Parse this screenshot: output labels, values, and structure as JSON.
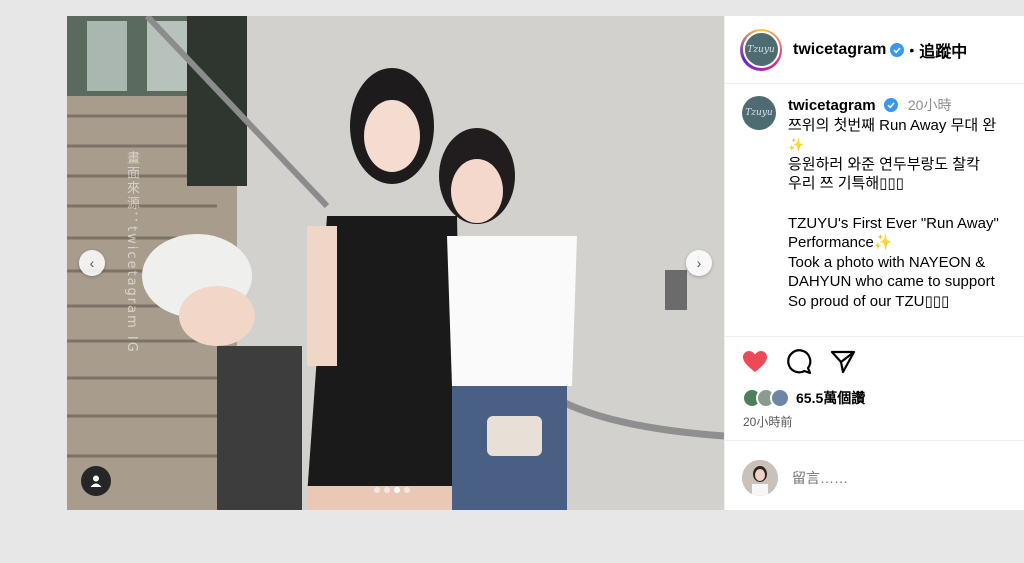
{
  "photo": {
    "watermark": "畫面來源：twicetagram IG",
    "nav_prev_label": "‹",
    "nav_next_label": "›",
    "carousel": {
      "count": 4,
      "active": 3
    }
  },
  "header": {
    "avatar_text": "Tzuyu",
    "username": "twicetagram",
    "separator": "•",
    "follow_label": "追蹤中"
  },
  "caption": {
    "avatar_text": "Tzuyu",
    "username": "twicetagram",
    "time": "20小時",
    "lines": [
      "쯔위의 첫번째 Run Away 무대 완",
      "✨",
      "응원하러 와준 연두부랑도 찰칵",
      "우리 쯔 기특해▯▯▯",
      "",
      "TZUYU's First Ever \"Run Away\"",
      "Performance✨",
      "Took a photo with NAYEON &",
      "DAHYUN who came to support",
      "So proud of our TZU▯▯▯"
    ]
  },
  "likes": {
    "count_text": "65.5萬個讚"
  },
  "post_time": "20小時前",
  "comment": {
    "placeholder": "留言……"
  },
  "colors": {
    "heart": "#ed4956",
    "verified": "#3897f0",
    "accent_text": "#000000"
  }
}
